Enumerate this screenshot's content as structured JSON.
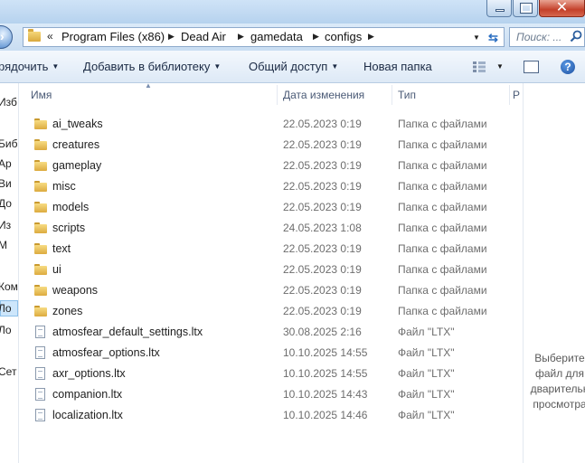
{
  "address": {
    "crumbs": [
      "Program Files (x86)",
      "Dead Air",
      "gamedata",
      "configs"
    ],
    "chevrons": "«"
  },
  "search": {
    "placeholder": "Поиск: ..."
  },
  "toolbar": {
    "organize": "рядочить",
    "add_to_library": "Добавить в библиотеку",
    "share": "Общий доступ",
    "new_folder": "Новая папка",
    "help": "?"
  },
  "nav_pane": {
    "items": [
      "Изб",
      "Биб",
      "Ар",
      "Ви",
      "До",
      "Из",
      "М",
      "Ком",
      "Ло",
      "Ло",
      "Сет"
    ]
  },
  "columns": {
    "name": "Имя",
    "date": "Дата изменения",
    "type": "Тип",
    "size": "Р"
  },
  "files": [
    {
      "name": "ai_tweaks",
      "date": "22.05.2023 0:19",
      "type": "Папка с файлами",
      "kind": "folder"
    },
    {
      "name": "creatures",
      "date": "22.05.2023 0:19",
      "type": "Папка с файлами",
      "kind": "folder"
    },
    {
      "name": "gameplay",
      "date": "22.05.2023 0:19",
      "type": "Папка с файлами",
      "kind": "folder"
    },
    {
      "name": "misc",
      "date": "22.05.2023 0:19",
      "type": "Папка с файлами",
      "kind": "folder"
    },
    {
      "name": "models",
      "date": "22.05.2023 0:19",
      "type": "Папка с файлами",
      "kind": "folder"
    },
    {
      "name": "scripts",
      "date": "24.05.2023 1:08",
      "type": "Папка с файлами",
      "kind": "folder"
    },
    {
      "name": "text",
      "date": "22.05.2023 0:19",
      "type": "Папка с файлами",
      "kind": "folder"
    },
    {
      "name": "ui",
      "date": "22.05.2023 0:19",
      "type": "Папка с файлами",
      "kind": "folder"
    },
    {
      "name": "weapons",
      "date": "22.05.2023 0:19",
      "type": "Папка с файлами",
      "kind": "folder"
    },
    {
      "name": "zones",
      "date": "22.05.2023 0:19",
      "type": "Папка с файлами",
      "kind": "folder"
    },
    {
      "name": "atmosfear_default_settings.ltx",
      "date": "30.08.2025 2:16",
      "type": "Файл \"LTX\"",
      "kind": "file"
    },
    {
      "name": "atmosfear_options.ltx",
      "date": "10.10.2025 14:55",
      "type": "Файл \"LTX\"",
      "kind": "file"
    },
    {
      "name": "axr_options.ltx",
      "date": "10.10.2025 14:55",
      "type": "Файл \"LTX\"",
      "kind": "file"
    },
    {
      "name": "companion.ltx",
      "date": "10.10.2025 14:43",
      "type": "Файл \"LTX\"",
      "kind": "file"
    },
    {
      "name": "localization.ltx",
      "date": "10.10.2025 14:46",
      "type": "Файл \"LTX\"",
      "kind": "file"
    }
  ],
  "preview": {
    "lines": [
      "Выберите",
      "файл для",
      "дварительн",
      "просмотра"
    ]
  },
  "icons": {
    "folder": "folder-icon",
    "file": "file-icon",
    "search": "search-icon",
    "help": "help-icon",
    "refresh": "refresh-icon"
  },
  "colors": {
    "toolbar_text": "#1b2a44",
    "meta_text": "#6d6d6d",
    "folder_yellow": "#dcab3f",
    "close_red": "#c4402a"
  }
}
